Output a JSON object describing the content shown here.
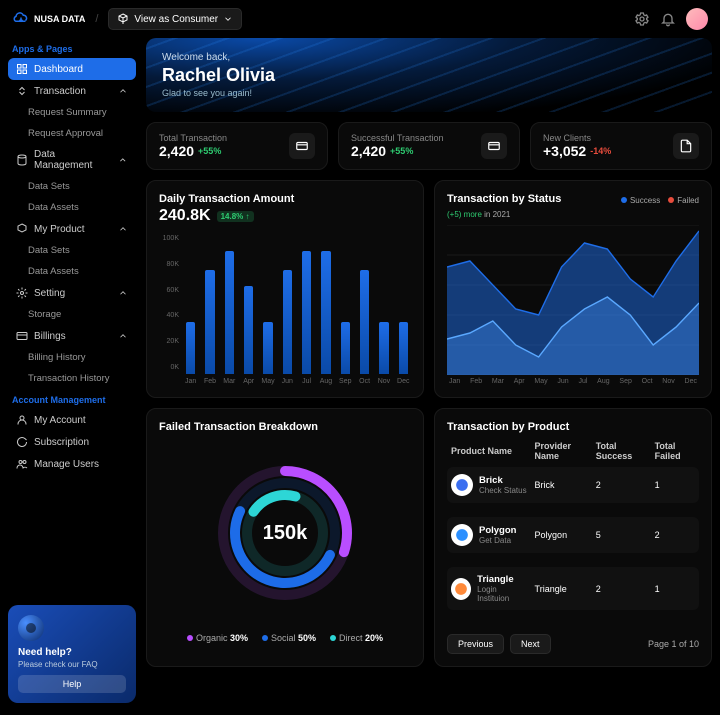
{
  "header": {
    "brand": "NUSA DATA",
    "view_as": "View as Consumer"
  },
  "sidebar": {
    "section_apps": "Apps & Pages",
    "dashboard": "Dashboard",
    "transaction": "Transaction",
    "req_summary": "Request Summary",
    "req_approval": "Request Approval",
    "data_mgmt": "Data Management",
    "data_sets": "Data Sets",
    "data_assets": "Data Assets",
    "my_product": "My Product",
    "mp_sets": "Data Sets",
    "mp_assets": "Data Assets",
    "setting": "Setting",
    "storage": "Storage",
    "billings": "Billings",
    "billing_hist": "Billing History",
    "txn_hist": "Transaction History",
    "section_acct": "Account Management",
    "my_account": "My Account",
    "subscription": "Subscription",
    "manage_users": "Manage Users"
  },
  "help": {
    "title": "Need help?",
    "sub": "Please check our FAQ",
    "btn": "Help"
  },
  "hero": {
    "welcome": "Welcome back,",
    "name": "Rachel Olivia",
    "glad": "Glad to see you again!"
  },
  "kpis": [
    {
      "label": "Total Transaction",
      "value": "2,420",
      "delta": "+55%",
      "neg": false,
      "icon": "wallet"
    },
    {
      "label": "Successful Transaction",
      "value": "2,420",
      "delta": "+55%",
      "neg": false,
      "icon": "wallet"
    },
    {
      "label": "New Clients",
      "value": "+3,052",
      "delta": "-14%",
      "neg": true,
      "icon": "doc"
    }
  ],
  "daily": {
    "title": "Daily Transaction Amount",
    "value": "240.8K",
    "badge": "14.8% ↑"
  },
  "status": {
    "title": "Transaction by Status",
    "sub_pre": "(+5) more ",
    "sub_post": "in 2021",
    "legend_success": "Success",
    "legend_failed": "Failed"
  },
  "chart_data": {
    "daily_bars": {
      "type": "bar",
      "title": "Daily Transaction Amount",
      "categories": [
        "Jan",
        "Feb",
        "Mar",
        "Apr",
        "May",
        "Jun",
        "Jul",
        "Aug",
        "Sep",
        "Oct",
        "Nov",
        "Dec"
      ],
      "values": [
        40,
        80,
        95,
        68,
        40,
        80,
        95,
        95,
        40,
        80,
        40,
        40
      ],
      "ylabel": "K",
      "ylim": [
        0,
        100
      ],
      "yticks": [
        "100K",
        "80K",
        "60K",
        "40K",
        "20K",
        "0K"
      ]
    },
    "status_area": {
      "type": "area",
      "title": "Transaction by Status",
      "categories": [
        "Jan",
        "Feb",
        "Mar",
        "Apr",
        "May",
        "Jun",
        "Jul",
        "Aug",
        "Sep",
        "Oct",
        "Nov",
        "Dec"
      ],
      "series": [
        {
          "name": "Success",
          "values": [
            360,
            380,
            300,
            220,
            200,
            360,
            440,
            420,
            320,
            260,
            380,
            480
          ]
        },
        {
          "name": "Failed",
          "values": [
            120,
            140,
            180,
            100,
            60,
            160,
            220,
            260,
            200,
            100,
            160,
            240
          ]
        }
      ],
      "ylim": [
        0,
        500
      ],
      "yticks": [
        "500",
        "400",
        "300",
        "200",
        "100",
        "0"
      ]
    },
    "failed_donut": {
      "type": "pie",
      "title": "Failed Transaction Breakdown",
      "center": "150k",
      "series": [
        {
          "name": "Organic",
          "value": 30,
          "color": "#b94eff"
        },
        {
          "name": "Social",
          "value": 50,
          "color": "#1e6de8"
        },
        {
          "name": "Direct",
          "value": 20,
          "color": "#2dd6d6"
        }
      ]
    }
  },
  "failed": {
    "title": "Failed Transaction Breakdown"
  },
  "product": {
    "title": "Transaction by Product",
    "cols": [
      "Product Name",
      "Provider Name",
      "Total Success",
      "Total Failed"
    ],
    "rows": [
      {
        "name": "Brick",
        "sub": "Check Status",
        "provider": "Brick",
        "succ": "2",
        "fail": "1",
        "color": "#3a6ef0"
      },
      {
        "name": "Polygon",
        "sub": "Get Data",
        "provider": "Polygon",
        "succ": "5",
        "fail": "2",
        "color": "#2a8fff"
      },
      {
        "name": "Triangle",
        "sub": "Login Instituion",
        "provider": "Triangle",
        "succ": "2",
        "fail": "1",
        "color": "#ff8a3a"
      }
    ],
    "prev": "Previous",
    "next": "Next",
    "page": "Page 1 of 10"
  }
}
